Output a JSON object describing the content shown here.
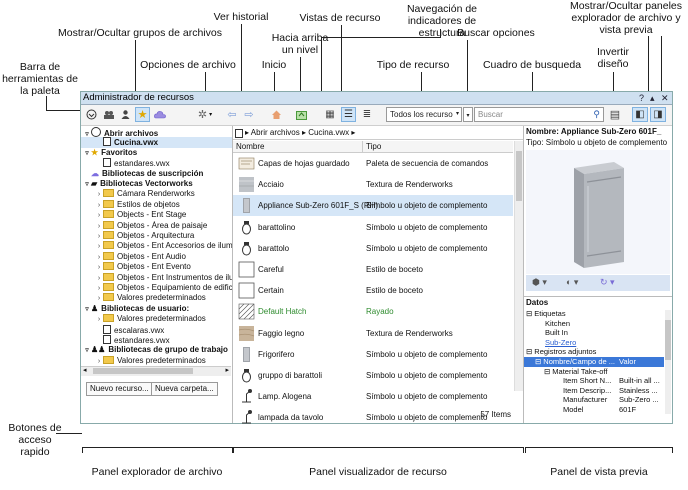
{
  "annotations": {
    "barra_herramientas": "Barra de herramientas de la paleta",
    "mostrar_ocultar_grupos": "Mostrar/Ocultar grupos de archivos",
    "opciones_archivo": "Opciones de archivo",
    "ver_historial": "Ver historial",
    "inicio": "Inicio",
    "hacia_arriba": "Hacia arriba un nivel",
    "vistas_recurso": "Vistas de recurso",
    "navegacion_indicadores": "Navegación de indicadores de estructura",
    "tipo_recurso": "Tipo de recurso",
    "buscar_opciones": "Buscar opciones",
    "cuadro_busqueda": "Cuadro de busqueda",
    "invertir_diseno": "Invertir diseño",
    "mostrar_ocultar_paneles": "Mostrar/Ocultar paneles explorador de archivo y vista previa",
    "botones_acceso": "Botones de acceso rapido",
    "panel_explorador": "Panel explorador de archivo",
    "panel_visualizador": "Panel visualizador de recurso",
    "panel_vista_previa": "Panel de vista previa"
  },
  "window": {
    "title": "Administrador de recursos",
    "controls": [
      "?",
      " ",
      "✕"
    ]
  },
  "toolbar": {
    "resource_type": "Todos los recurso",
    "search_placeholder": "Buscar"
  },
  "file_tree": [
    {
      "label": "Abrir archivos",
      "level": 0,
      "twisty": "▿",
      "icon": "circle-arrow",
      "bold": true
    },
    {
      "label": "Cucina.vwx",
      "level": 1,
      "icon": "doc",
      "selected": true,
      "bold": true
    },
    {
      "label": "Favoritos",
      "level": 0,
      "twisty": "▿",
      "icon": "star",
      "bold": true
    },
    {
      "label": "estandares.vwx",
      "level": 1,
      "icon": "doc"
    },
    {
      "label": "Bibliotecas de suscripción",
      "level": 0,
      "icon": "cloud",
      "bold": true
    },
    {
      "label": "Bibliotecas Vectorworks",
      "level": 0,
      "twisty": "▿",
      "icon": "library",
      "bold": true
    },
    {
      "label": "Cámara Renderworks",
      "level": 1,
      "twisty": "›",
      "icon": "folder"
    },
    {
      "label": "Estilos de objetos",
      "level": 1,
      "twisty": "›",
      "icon": "folder"
    },
    {
      "label": "Objects - Ent Stage",
      "level": 1,
      "twisty": "›",
      "icon": "folder"
    },
    {
      "label": "Objetos - Área de paisaje",
      "level": 1,
      "twisty": "›",
      "icon": "folder"
    },
    {
      "label": "Objetos - Arquitectura",
      "level": 1,
      "twisty": "›",
      "icon": "folder"
    },
    {
      "label": "Objetos - Ent Accesorios de ilumi",
      "level": 1,
      "twisty": "›",
      "icon": "folder"
    },
    {
      "label": "Objetos - Ent Audio",
      "level": 1,
      "twisty": "›",
      "icon": "folder"
    },
    {
      "label": "Objetos - Ent Evento",
      "level": 1,
      "twisty": "›",
      "icon": "folder"
    },
    {
      "label": "Objetos - Ent Instrumentos de ilur",
      "level": 1,
      "twisty": "›",
      "icon": "folder"
    },
    {
      "label": "Objetos - Equipamiento de edifici",
      "level": 1,
      "twisty": "›",
      "icon": "folder"
    },
    {
      "label": "Valores predeterminados",
      "level": 1,
      "twisty": "›",
      "icon": "folder"
    },
    {
      "label": "Bibliotecas de usuario:",
      "level": 0,
      "twisty": "▿",
      "icon": "user",
      "bold": true
    },
    {
      "label": "Valores predeterminados",
      "level": 1,
      "twisty": "›",
      "icon": "folder"
    },
    {
      "label": "escalaras.vwx",
      "level": 1,
      "icon": "doc"
    },
    {
      "label": "estandares.vwx",
      "level": 1,
      "icon": "doc"
    },
    {
      "label": "Bibliotecas de grupo de trabajo",
      "level": 0,
      "twisty": "▿",
      "icon": "group",
      "bold": true
    },
    {
      "label": "Valores predeterminados",
      "level": 1,
      "twisty": "›",
      "icon": "folder"
    }
  ],
  "quick_buttons": {
    "new_resource": "Nuevo recurso...",
    "new_folder": "Nueva carpeta..."
  },
  "viewer": {
    "breadcrumb": [
      "Abrir archivos",
      "Cucina.vwx"
    ],
    "columns": {
      "name": "Nombre",
      "type": "Tipo"
    },
    "rows": [
      {
        "name": "Capas de hojas guardado",
        "type": "Paleta de secuencia de comandos",
        "icon": "script",
        "color": "#111111"
      },
      {
        "name": "Acciaio",
        "type": "Textura de Renderworks",
        "icon": "texture",
        "color": "#111111"
      },
      {
        "name": "Appliance Sub-Zero 601F_S (RH)",
        "type": "Símbolo u objeto de complemento",
        "icon": "fridge",
        "color": "#111111",
        "selected": true
      },
      {
        "name": "barattolino",
        "type": "Símbolo u objeto de complemento",
        "icon": "jar",
        "color": "#111111"
      },
      {
        "name": "barattolo",
        "type": "Símbolo u objeto de complemento",
        "icon": "jar",
        "color": "#111111"
      },
      {
        "name": "Careful",
        "type": "Estilo de boceto",
        "icon": "blank",
        "color": "#111111"
      },
      {
        "name": "Certain",
        "type": "Estilo de boceto",
        "icon": "blank",
        "color": "#111111"
      },
      {
        "name": "Default Hatch",
        "type": "Rayado",
        "icon": "hatch",
        "color": "#2e8b2e"
      },
      {
        "name": "Faggio legno",
        "type": "Textura de Renderworks",
        "icon": "wood",
        "color": "#111111"
      },
      {
        "name": "Frigorifero",
        "type": "Símbolo u objeto de complemento",
        "icon": "fridge",
        "color": "#111111"
      },
      {
        "name": "gruppo di barattoli",
        "type": "Símbolo u objeto de complemento",
        "icon": "jar",
        "color": "#111111"
      },
      {
        "name": "Lamp. Alogena",
        "type": "Símbolo u objeto de complemento",
        "icon": "lamp",
        "color": "#111111"
      },
      {
        "name": "lampada da tavolo",
        "type": "Símbolo u objeto de complemento",
        "icon": "lamp",
        "color": "#111111"
      }
    ],
    "count": "57 Items"
  },
  "preview": {
    "name": "Nombre: Appliance Sub-Zero 601F_",
    "type": "Tipo: Símbolo u objeto de complemento",
    "data_title": "Datos",
    "data_rows": [
      {
        "text": "Etiquetas",
        "level": 0,
        "twisty": "⊟"
      },
      {
        "text": "Kitchen",
        "level": 1
      },
      {
        "text": "Built In",
        "level": 1
      },
      {
        "text": "Sub-Zero",
        "level": 1,
        "link": true
      },
      {
        "text": "Registros adjuntos",
        "level": 0,
        "twisty": "⊟"
      },
      {
        "text": "Nombre/Campo de ...",
        "value": "Valor",
        "level": 1,
        "twisty": "⊟",
        "header": true
      },
      {
        "text": "Material Take-off",
        "level": 2,
        "twisty": "⊟"
      },
      {
        "text": "Item Short N...",
        "value": "Built-in all ...",
        "level": 3
      },
      {
        "text": "Item Descrip...",
        "value": "Stainless ...",
        "level": 3
      },
      {
        "text": "Manufacturer",
        "value": "Sub-Zero ...",
        "level": 3
      },
      {
        "text": "Model",
        "value": "601F",
        "level": 3
      }
    ]
  }
}
